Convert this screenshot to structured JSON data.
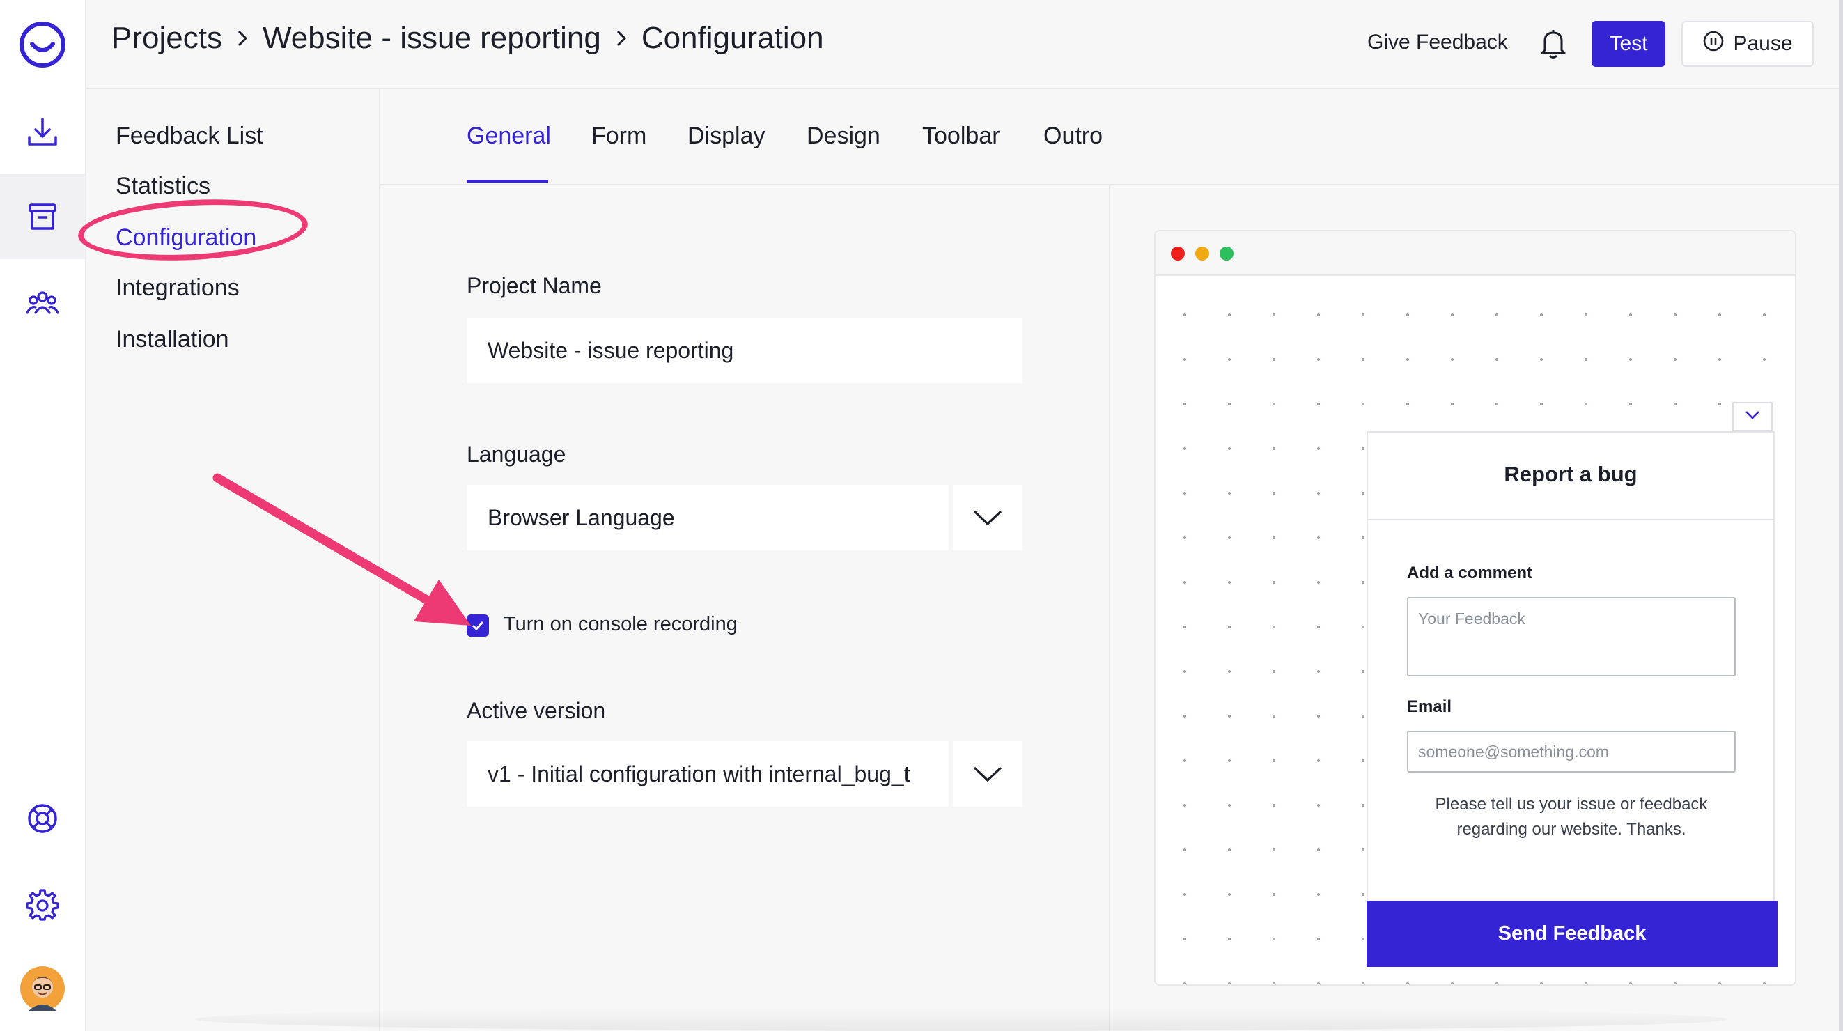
{
  "breadcrumb": {
    "items": [
      "Projects",
      "Website - issue reporting",
      "Configuration"
    ]
  },
  "header": {
    "give_feedback": "Give Feedback",
    "test_label": "Test",
    "pause_label": "Pause"
  },
  "rail": {
    "icons": [
      "logo-icon",
      "download-icon",
      "inbox-icon",
      "team-icon",
      "help-lifebuoy-icon",
      "settings-gear-icon",
      "user-avatar"
    ]
  },
  "subnav": {
    "items": [
      {
        "label": "Feedback List"
      },
      {
        "label": "Statistics"
      },
      {
        "label": "Configuration",
        "active": true
      },
      {
        "label": "Integrations"
      },
      {
        "label": "Installation"
      }
    ]
  },
  "tabs": [
    {
      "label": "General",
      "active": true
    },
    {
      "label": "Form"
    },
    {
      "label": "Display"
    },
    {
      "label": "Design"
    },
    {
      "label": "Toolbar"
    },
    {
      "label": "Outro"
    }
  ],
  "form": {
    "project_name_label": "Project Name",
    "project_name_value": "Website - issue reporting",
    "language_label": "Language",
    "language_value": "Browser Language",
    "console_recording_label": "Turn on console recording",
    "console_recording_checked": true,
    "active_version_label": "Active version",
    "active_version_value": "v1 - Initial configuration with internal_bug_t"
  },
  "preview": {
    "widget_title": "Report a bug",
    "comment_label": "Add a comment",
    "comment_placeholder": "Your Feedback",
    "email_label": "Email",
    "email_placeholder": "someone@something.com",
    "note_line1": "Please tell us your issue or feedback",
    "note_line2": "regarding our website.  Thanks.",
    "send_label": "Send Feedback"
  },
  "colors": {
    "accent": "#3524d3",
    "annotation": "#ee3a74",
    "window_dot_red": "#f0201c",
    "window_dot_yellow": "#f0a913",
    "window_dot_green": "#2bbf5e"
  }
}
